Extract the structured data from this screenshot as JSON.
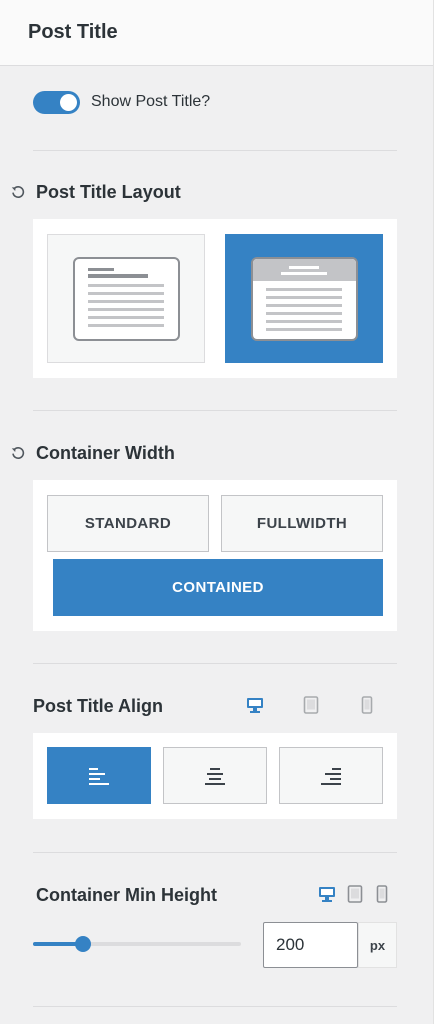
{
  "header": {
    "title": "Post Title"
  },
  "show_title": {
    "label": "Show Post Title?",
    "enabled": true
  },
  "layout": {
    "title": "Post Title Layout",
    "options": [
      {
        "name": "normal",
        "selected": false
      },
      {
        "name": "above",
        "selected": true
      }
    ]
  },
  "container_width": {
    "title": "Container Width",
    "options": [
      "STANDARD",
      "FULLWIDTH",
      "CONTAINED"
    ],
    "selected": "CONTAINED"
  },
  "align": {
    "title": "Post Title Align",
    "options": [
      "left",
      "center",
      "right"
    ],
    "selected": "left",
    "active_device": "desktop"
  },
  "min_height": {
    "title": "Container Min Height",
    "value": "200",
    "unit": "px",
    "slider_fraction": 0.24,
    "active_device": "desktop"
  },
  "colors": {
    "accent": "#3582c4",
    "panel": "#ffffff",
    "background": "#f0f0f1"
  },
  "icons": [
    "reset-icon",
    "desktop-icon",
    "tablet-icon",
    "mobile-icon",
    "align-left-icon",
    "align-center-icon",
    "align-right-icon"
  ]
}
